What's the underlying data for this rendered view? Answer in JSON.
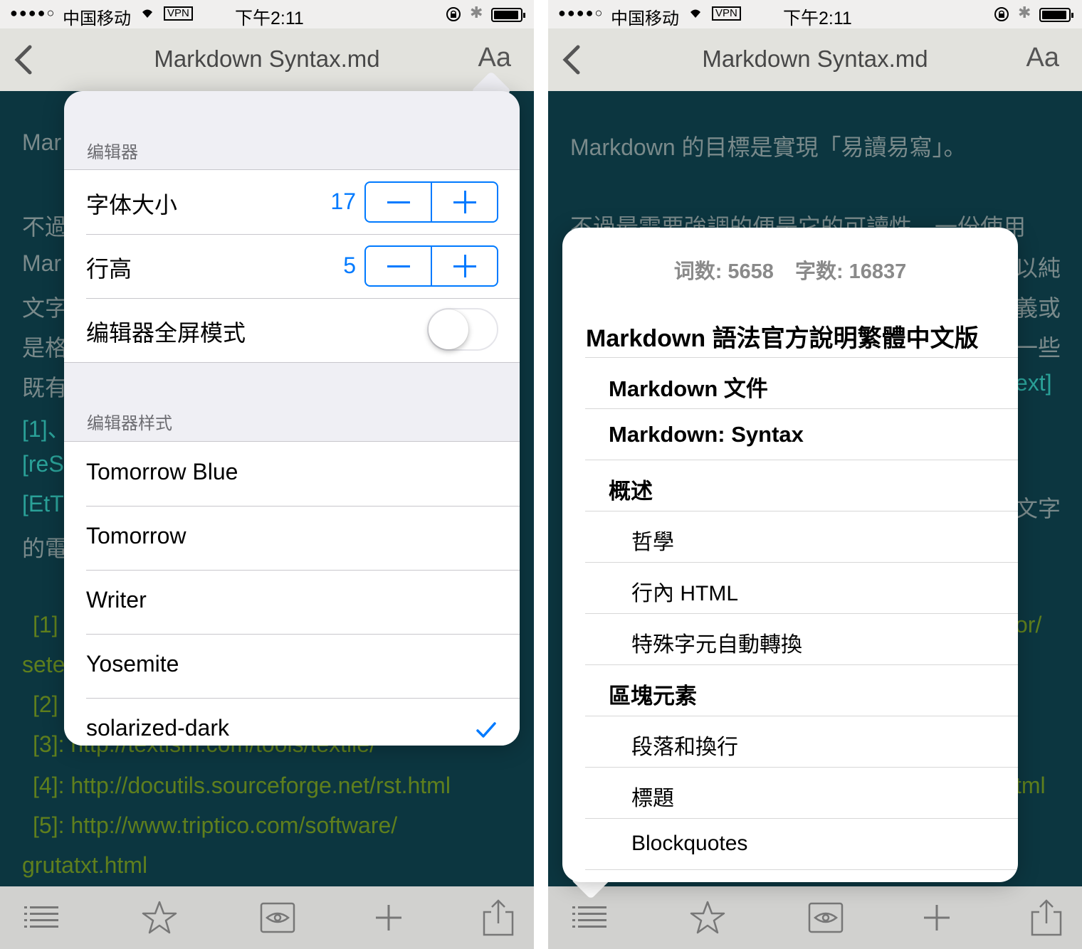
{
  "status_bar": {
    "signal": "●●●●○",
    "carrier": "中国移动",
    "vpn": "VPN",
    "time": "下午2:11"
  },
  "nav": {
    "title": "Markdown Syntax.md",
    "font_button": "Aa"
  },
  "editor_left": {
    "lines": [
      "Mar",
      "不過",
      "Mar",
      "文字",
      "是格",
      "既有",
      "[1]、",
      "[reS",
      "[EtT",
      "的電",
      "[1]",
      "sete",
      "[2]",
      "[3]: http://textism.com/tools/textile/",
      "[4]: http://docutils.sourceforge.net/rst.html",
      "[5]: http://www.triptico.com/software/",
      "grutatxt.html"
    ]
  },
  "editor_right": {
    "lines": [
      "Markdown 的目標是實現「易讀易寫」。",
      "不過最需要強調的便是它的可讀性，一份使用",
      "以純",
      "義或",
      "一些",
      "ext]",
      "文字",
      "or/",
      "tml"
    ]
  },
  "settings": {
    "section_editor": "编辑器",
    "font_size_label": "字体大小",
    "font_size_value": "17",
    "line_height_label": "行高",
    "line_height_value": "5",
    "fullscreen_label": "编辑器全屏模式",
    "fullscreen_on": false,
    "section_style": "编辑器样式",
    "themes": [
      "Tomorrow Blue",
      "Tomorrow",
      "Writer",
      "Yosemite",
      "solarized-dark"
    ],
    "selected_theme": "solarized-dark",
    "accent_color": "#007aff"
  },
  "outline": {
    "word_count": "词数: 5658",
    "char_count": "字数: 16837",
    "doc_title": "Markdown 語法官方說明繁體中文版",
    "items": [
      {
        "level": 2,
        "text": "Markdown 文件"
      },
      {
        "level": 2,
        "text": "Markdown: Syntax"
      },
      {
        "level": 2,
        "text": "概述"
      },
      {
        "level": 3,
        "text": "哲學"
      },
      {
        "level": 3,
        "text": "行內 HTML"
      },
      {
        "level": 3,
        "text": "特殊字元自動轉換"
      },
      {
        "level": 2,
        "text": "區塊元素"
      },
      {
        "level": 3,
        "text": "段落和換行"
      },
      {
        "level": 3,
        "text": "標題"
      },
      {
        "level": 3,
        "text": "Blockquotes"
      }
    ]
  },
  "toolbar": {
    "icons": [
      "list-icon",
      "star-icon",
      "preview-eye-icon",
      "plus-icon",
      "share-icon"
    ]
  },
  "colors": {
    "editor_bg": "#0c3640",
    "editor_text": "#7a8a8b",
    "link_text": "#5f7f1d",
    "cyan_text": "#2aa198"
  }
}
